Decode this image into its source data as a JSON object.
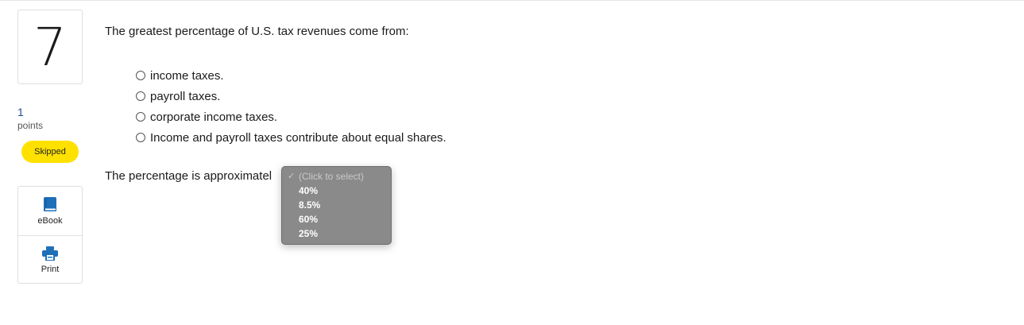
{
  "question": {
    "number": "7",
    "points_value": "1",
    "points_label": "points",
    "status_badge": "Skipped",
    "prompt": "The greatest percentage of U.S. tax revenues come from:",
    "options": [
      "income taxes.",
      "payroll taxes.",
      "corporate income taxes.",
      "Income and payroll taxes contribute about equal shares."
    ],
    "fill_in_prefix": "The percentage is approximatel"
  },
  "tools": {
    "ebook_label": "eBook",
    "print_label": "Print"
  },
  "dropdown": {
    "checkmark": "✓",
    "placeholder": "(Click to select)",
    "options": [
      "40%",
      "8.5%",
      "60%",
      "25%"
    ]
  },
  "colors": {
    "badge": "#ffe100",
    "points_number": "#1f4e8c",
    "icon_blue": "#1f6fb8",
    "menu_bg": "#8a8a8a"
  }
}
